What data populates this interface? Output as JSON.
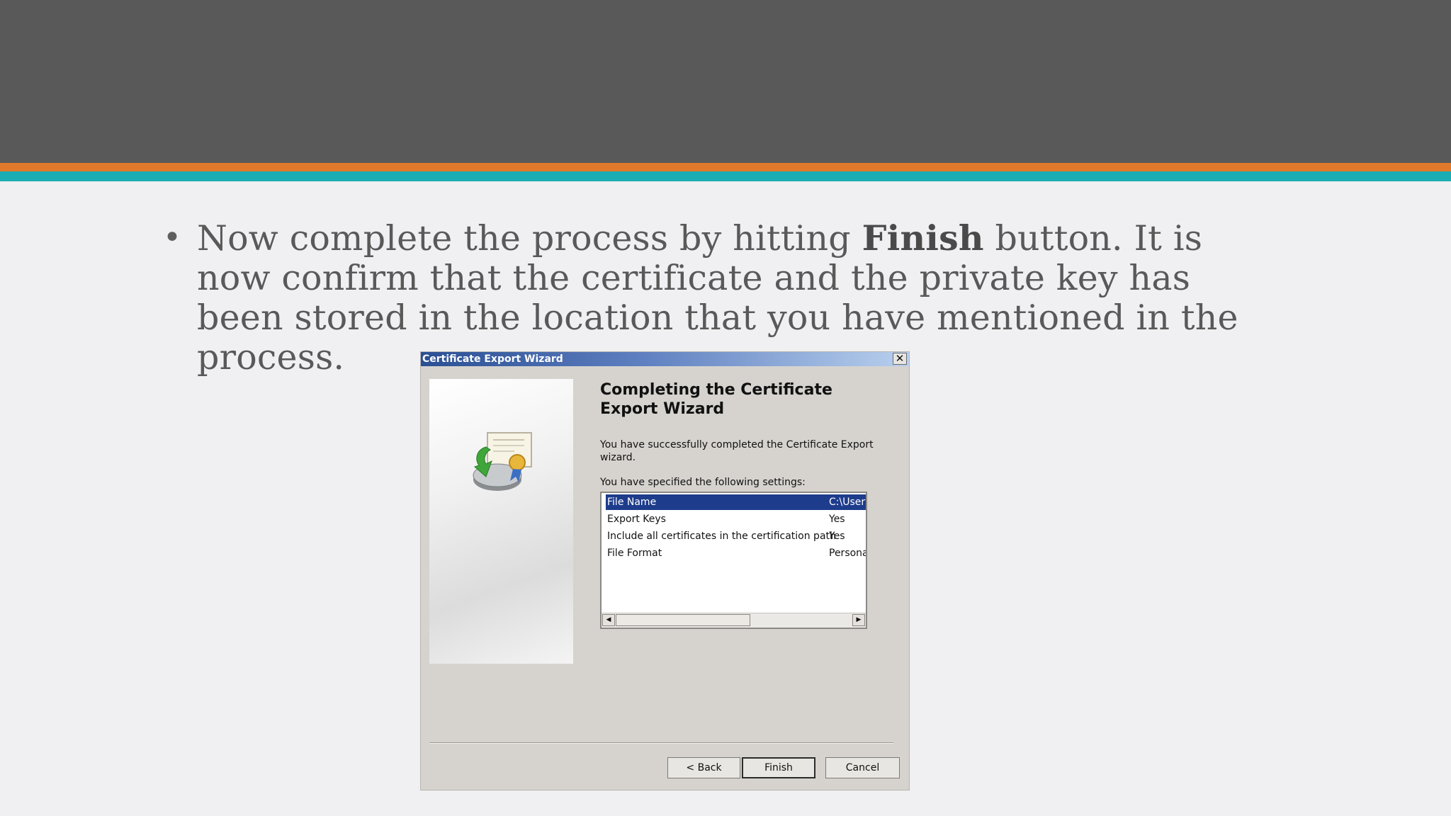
{
  "slide": {
    "bullet_symbol": "•",
    "text_before": "Now complete the process by hitting ",
    "text_bold": "Finish",
    "text_after": " button. It is now confirm that the certificate and the private key has been stored in the location that you have mentioned in the process."
  },
  "dialog": {
    "title": "Certificate Export Wizard",
    "close_symbol": "✕",
    "heading": "Completing the Certificate Export Wizard",
    "description": "You have successfully completed the Certificate Export wizard.",
    "settings_label": "You have specified the following settings:",
    "settings": [
      {
        "key": "File Name",
        "value": "C:\\User",
        "selected": true
      },
      {
        "key": "Export Keys",
        "value": "Yes",
        "selected": false
      },
      {
        "key": "Include all certificates in the certification path",
        "value": "Yes",
        "selected": false
      },
      {
        "key": "File Format",
        "value": "Persona",
        "selected": false
      }
    ],
    "scroll_left_symbol": "◀",
    "scroll_right_symbol": "▶",
    "buttons": {
      "back": "< Back",
      "finish": "Finish",
      "cancel": "Cancel"
    }
  },
  "colors": {
    "header": "#595959",
    "stripe_orange": "#e07a2a",
    "stripe_teal": "#1aadb3",
    "selection": "#1e3c8c"
  },
  "icons": {
    "wizard_icon": "certificate-export-icon"
  }
}
